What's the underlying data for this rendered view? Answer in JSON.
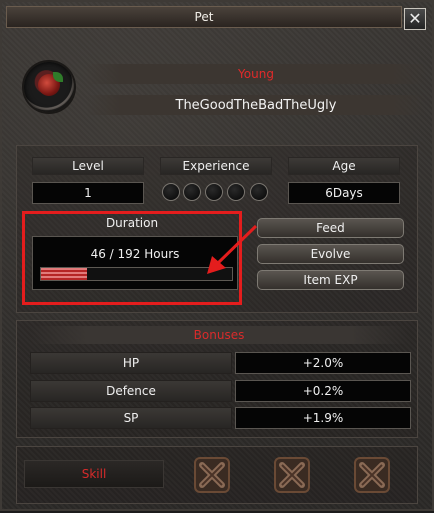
{
  "window": {
    "title": "Pet",
    "close_glyph": "✕"
  },
  "pet": {
    "stage": "Young",
    "name": "TheGoodTheBadTheUgly",
    "avatar_icon": "pet-egg-icon"
  },
  "stats": {
    "level_label": "Level",
    "level_value": "1",
    "experience_label": "Experience",
    "experience_slots": 5,
    "age_label": "Age",
    "age_value": "6Days"
  },
  "duration": {
    "label": "Duration",
    "text": "46 / 192 Hours",
    "progress_fraction": 0.24
  },
  "actions": {
    "feed": "Feed",
    "evolve": "Evolve",
    "item_exp": "Item EXP"
  },
  "bonuses": {
    "header": "Bonuses",
    "rows": [
      {
        "label": "HP",
        "value": "+2.0%"
      },
      {
        "label": "Defence",
        "value": "+0.2%"
      },
      {
        "label": "SP",
        "value": "+1.9%"
      }
    ]
  },
  "skill": {
    "label": "Skill",
    "slot_icon": "locked-slot-icon",
    "slot_count": 3
  },
  "colors": {
    "highlight": "#e41d1d",
    "bonus_header": "#d82b2b",
    "stage_text": "#e12a2a",
    "progress_fill": "#b62525"
  }
}
